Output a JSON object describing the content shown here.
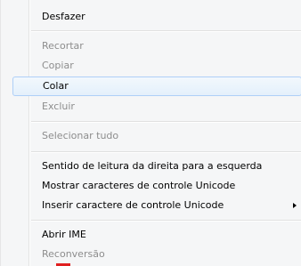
{
  "context_menu": {
    "items": [
      {
        "label": "Desfazer",
        "enabled": true
      },
      {
        "label": "Recortar",
        "enabled": false
      },
      {
        "label": "Copiar",
        "enabled": false
      },
      {
        "label": "Colar",
        "enabled": true,
        "highlighted": true
      },
      {
        "label": "Excluir",
        "enabled": false
      },
      {
        "label": "Selecionar tudo",
        "enabled": false
      },
      {
        "label": "Sentido de leitura da direita para a esquerda",
        "enabled": true
      },
      {
        "label": "Mostrar caracteres de controle Unicode",
        "enabled": true
      },
      {
        "label": "Inserir caractere de controle Unicode",
        "enabled": true,
        "has_submenu": true
      },
      {
        "label": "Abrir IME",
        "enabled": true
      },
      {
        "label": "Reconversão",
        "enabled": false
      }
    ]
  },
  "colors": {
    "menu_background": "#f5f6f7",
    "highlight_border": "#aecff7",
    "disabled_text": "#8d8d8d"
  }
}
